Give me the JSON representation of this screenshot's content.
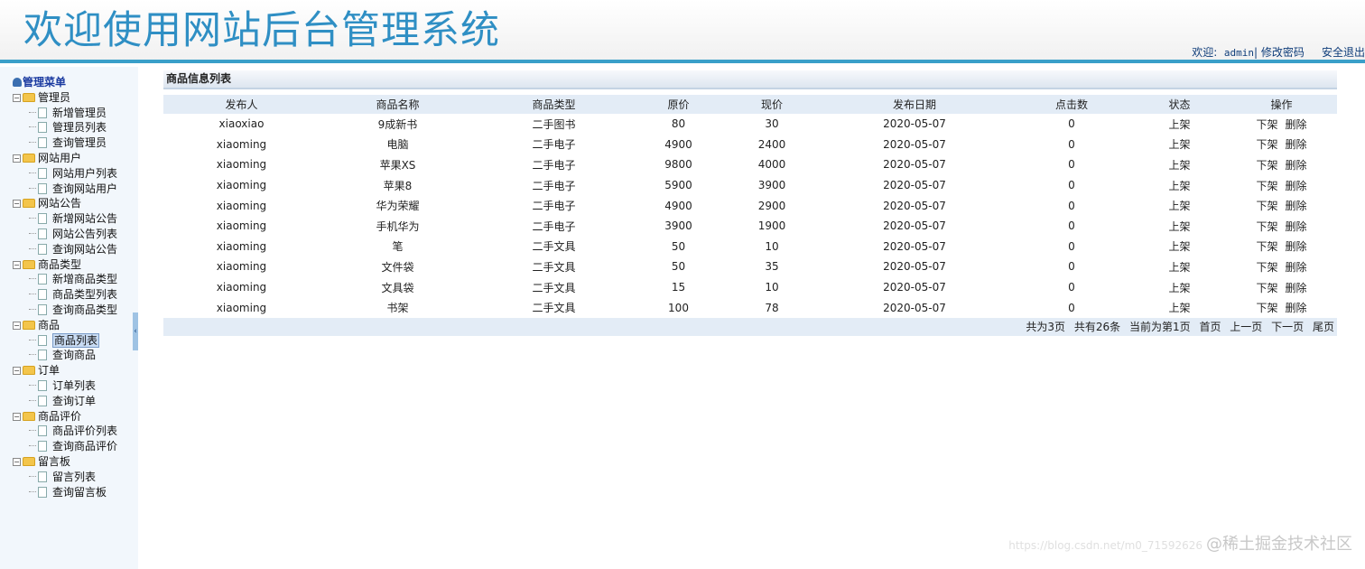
{
  "header": {
    "title": "欢迎使用网站后台管理系统",
    "welcome": "欢迎:",
    "username": "admin",
    "separator": "|",
    "change_password": "修改密码",
    "logout": "安全退出"
  },
  "sidebar": {
    "root": "管理菜单",
    "groups": [
      {
        "label": "管理员",
        "items": [
          "新增管理员",
          "管理员列表",
          "查询管理员"
        ]
      },
      {
        "label": "网站用户",
        "items": [
          "网站用户列表",
          "查询网站用户"
        ]
      },
      {
        "label": "网站公告",
        "items": [
          "新增网站公告",
          "网站公告列表",
          "查询网站公告"
        ]
      },
      {
        "label": "商品类型",
        "items": [
          "新增商品类型",
          "商品类型列表",
          "查询商品类型"
        ]
      },
      {
        "label": "商品",
        "items": [
          "商品列表",
          "查询商品"
        ]
      },
      {
        "label": "订单",
        "items": [
          "订单列表",
          "查询订单"
        ]
      },
      {
        "label": "商品评价",
        "items": [
          "商品评价列表",
          "查询商品评价"
        ]
      },
      {
        "label": "留言板",
        "items": [
          "留言列表",
          "查询留言板"
        ]
      }
    ],
    "active_item": "商品列表",
    "collapse_glyph": "‹"
  },
  "main": {
    "panel_title": "商品信息列表",
    "columns": [
      "发布人",
      "商品名称",
      "商品类型",
      "原价",
      "现价",
      "发布日期",
      "点击数",
      "状态",
      "操作"
    ],
    "rows": [
      [
        "xiaoxiao",
        "9成新书",
        "二手图书",
        "80",
        "30",
        "2020-05-07",
        "0",
        "上架"
      ],
      [
        "xiaoming",
        "电脑",
        "二手电子",
        "4900",
        "2400",
        "2020-05-07",
        "0",
        "上架"
      ],
      [
        "xiaoming",
        "苹果XS",
        "二手电子",
        "9800",
        "4000",
        "2020-05-07",
        "0",
        "上架"
      ],
      [
        "xiaoming",
        "苹果8",
        "二手电子",
        "5900",
        "3900",
        "2020-05-07",
        "0",
        "上架"
      ],
      [
        "xiaoming",
        "华为荣耀",
        "二手电子",
        "4900",
        "2900",
        "2020-05-07",
        "0",
        "上架"
      ],
      [
        "xiaoming",
        "手机华为",
        "二手电子",
        "3900",
        "1900",
        "2020-05-07",
        "0",
        "上架"
      ],
      [
        "xiaoming",
        "笔",
        "二手文具",
        "50",
        "10",
        "2020-05-07",
        "0",
        "上架"
      ],
      [
        "xiaoming",
        "文件袋",
        "二手文具",
        "50",
        "35",
        "2020-05-07",
        "0",
        "上架"
      ],
      [
        "xiaoming",
        "文具袋",
        "二手文具",
        "15",
        "10",
        "2020-05-07",
        "0",
        "上架"
      ],
      [
        "xiaoming",
        "书架",
        "二手文具",
        "100",
        "78",
        "2020-05-07",
        "0",
        "上架"
      ]
    ],
    "row_actions": [
      "下架",
      "删除"
    ],
    "pager": {
      "total_pages": "共为3页",
      "total_records": "共有26条",
      "current": "当前为第1页",
      "first": "首页",
      "prev": "上一页",
      "next": "下一页",
      "last": "尾页"
    }
  },
  "watermark": {
    "url": "https://blog.csdn.net/m0_71592626",
    "text": "@稀土掘金技术社区"
  },
  "colors": {
    "title": "#2f8fc4",
    "header_line": "#3a9fc9",
    "sidebar_bg": "#f2f7fc",
    "table_header_bg": "#e3ecf6"
  }
}
